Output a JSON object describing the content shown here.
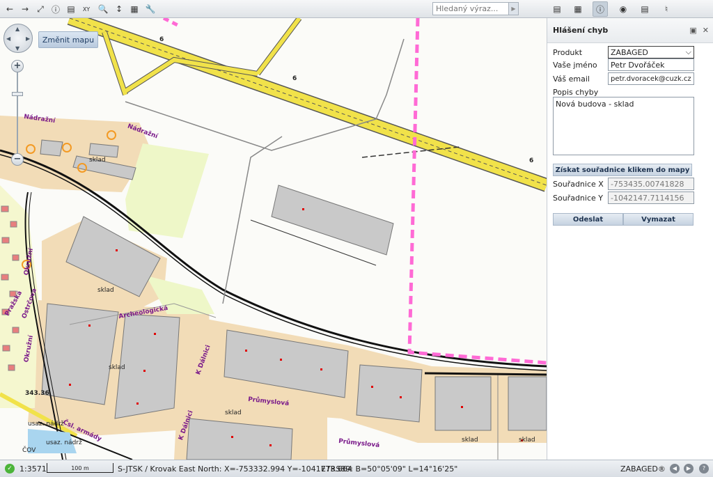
{
  "toolbar": {
    "left_icons": [
      "back-arrow-icon",
      "forward-arrow-icon",
      "full-extent-icon",
      "info-icon",
      "print-icon",
      "xy-coordinate-icon",
      "zoom-xy-icon",
      "measure-icon",
      "table-icon",
      "tools-icon"
    ],
    "search_placeholder": "Hledaný výraz...",
    "right_icons": [
      "layers-icon",
      "grid-icon",
      "info-panel-icon",
      "globe-icon",
      "print-panel-icon",
      "binoculars-icon"
    ]
  },
  "map": {
    "change_map_label": "Změnit mapu",
    "road_number": "6",
    "labels": {
      "sklad": "sklad",
      "nadrazni": "Nádražní",
      "archeologicka": "Archeologická",
      "prumyslova": "Průmyslová",
      "k_dalnici": "K Dálnici",
      "cs_armady": "Čsl. armády",
      "usaz_nadrz": "usaz. nádrž",
      "cov": "ČOV",
      "elevation": "343.36",
      "okruzni": "Okružní",
      "prazska": "Pražská",
      "ostrcova": "Ostrčova"
    }
  },
  "panel": {
    "title": "Hlášení chyb",
    "product_label": "Produkt",
    "product_value": "ZABAGED",
    "name_label": "Vaše jméno",
    "name_value": "Petr Dvořáček",
    "email_label": "Váš email",
    "email_value": "petr.dvoracek@cuzk.cz",
    "desc_label": "Popis chyby",
    "desc_value": "Nová budova - sklad",
    "get_coords_button": "Získat souřadnice klikem do mapy",
    "x_label": "Souřadnice X",
    "x_value": "-753435.00741828",
    "y_label": "Souřadnice Y",
    "y_value": "-1042147.7114156",
    "send_button": "Odeslat",
    "clear_button": "Vymazat"
  },
  "status": {
    "scale": "1:3571",
    "scalebar_label": "100 m",
    "coords": "S-JTSK / Krovak East North: X=-753332.994 Y=-1041773.664",
    "etrs": "ETRS89: B=50°05'09\" L=14°16'25\"",
    "brand": "ZABAGED®"
  }
}
